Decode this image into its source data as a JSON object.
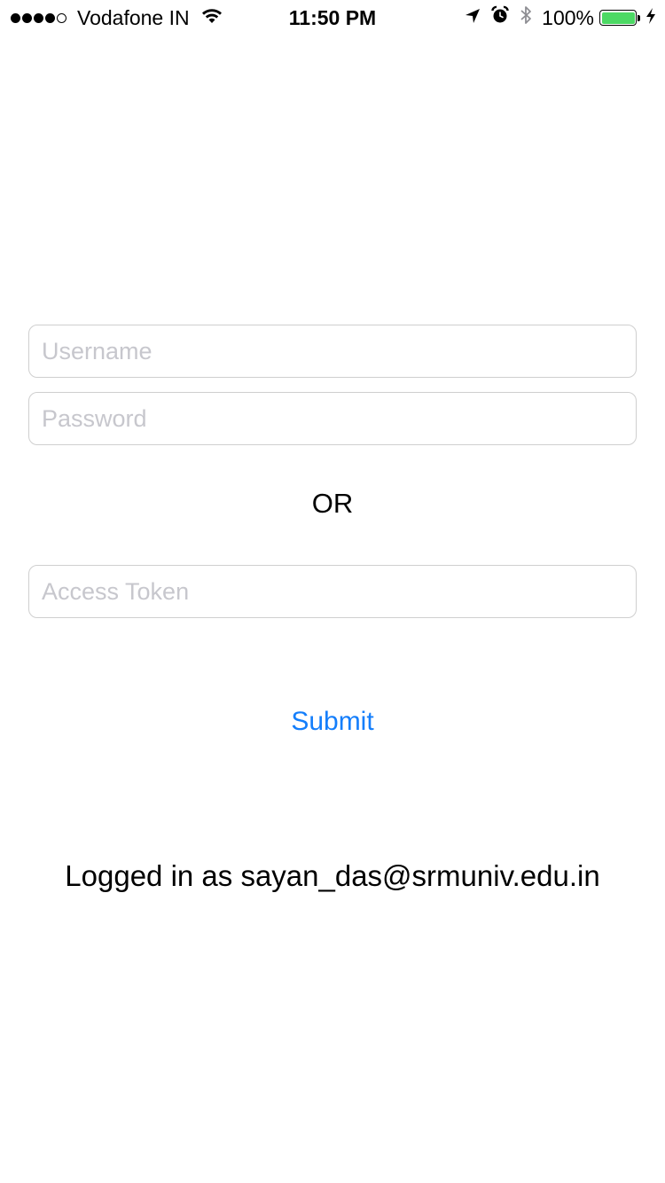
{
  "status_bar": {
    "carrier": "Vodafone IN",
    "time": "11:50 PM",
    "battery_percent": "100%",
    "battery_level": 1.0,
    "signal_bars_filled": 4,
    "signal_bars_total": 5,
    "icons": [
      "wifi-icon",
      "location-icon",
      "alarm-icon",
      "bluetooth-icon",
      "battery-icon",
      "charging-icon"
    ]
  },
  "form": {
    "username_placeholder": "Username",
    "password_placeholder": "Password",
    "or_label": "OR",
    "token_placeholder": "Access Token",
    "submit_label": "Submit"
  },
  "status_message": "Logged in as sayan_das@srmuniv.edu.in",
  "colors": {
    "accent": "#147efb",
    "placeholder": "#c7c7cd",
    "field_border": "#cfcfcf",
    "battery_fill": "#4cd964"
  }
}
